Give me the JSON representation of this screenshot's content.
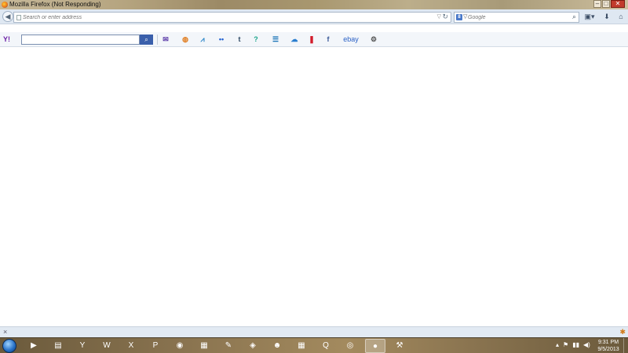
{
  "window": {
    "title": "Mozilla Firefox (Not Responding)",
    "buttons": {
      "minimize": "–",
      "maximize": "□",
      "close": "✕"
    }
  },
  "navbar": {
    "back_glyph": "◀",
    "url_placeholder": "Search or enter address",
    "search_engine_letter": "8",
    "search_placeholder": "Google",
    "dropdown_glyph": "▽",
    "reload_glyph": "↻",
    "search_glyph": "⌕",
    "icons": {
      "bookmarks": "▣▾",
      "downloads": "⬇",
      "home": "⌂"
    }
  },
  "yahoo_toolbar": {
    "logo": "Y!",
    "search_value": "",
    "search_button_glyph": "⌕",
    "items": [
      {
        "name": "mail-icon",
        "glyph": "✉",
        "color": "#5b3aa8"
      },
      {
        "name": "sports-icon",
        "glyph": "◍",
        "color": "#e07b1d"
      },
      {
        "name": "finance-icon",
        "glyph": "⩘",
        "color": "#1f7fc6"
      },
      {
        "name": "flickr-icon",
        "glyph": "••",
        "color": "#1f5fd0"
      },
      {
        "name": "tumblr-icon",
        "glyph": "t",
        "color": "#2c4762"
      },
      {
        "name": "answers-icon",
        "glyph": "?",
        "color": "#1aa58a"
      },
      {
        "name": "news-icon",
        "glyph": "☰",
        "color": "#1b75b8"
      },
      {
        "name": "weather-icon",
        "glyph": "☁",
        "color": "#2a7ecf"
      },
      {
        "name": "bookmark-icon",
        "glyph": "❚",
        "color": "#d21b2a"
      },
      {
        "name": "facebook-icon",
        "glyph": "f",
        "color": "#3b5998"
      },
      {
        "name": "ebay-icon",
        "glyph": "ebay",
        "color": "#2b61c6"
      },
      {
        "name": "settings-gear-icon",
        "glyph": "⚙",
        "color": "#555555"
      }
    ]
  },
  "addon_bar": {
    "close_glyph": "×",
    "addon_glyph": "✱"
  },
  "taskbar": {
    "items": [
      {
        "name": "media-center-icon",
        "glyph": "▶",
        "active": false
      },
      {
        "name": "explorer-folder-icon",
        "glyph": "▤",
        "active": false
      },
      {
        "name": "yahoo-messenger-icon",
        "glyph": "Y",
        "active": false
      },
      {
        "name": "word-icon",
        "glyph": "W",
        "active": false
      },
      {
        "name": "excel-icon",
        "glyph": "X",
        "active": false
      },
      {
        "name": "powerpoint-icon",
        "glyph": "P",
        "active": false
      },
      {
        "name": "network-icon",
        "glyph": "◉",
        "active": false
      },
      {
        "name": "archive-icon",
        "glyph": "▦",
        "active": false
      },
      {
        "name": "pen-app-icon",
        "glyph": "✎",
        "active": false
      },
      {
        "name": "hunger-games-icon",
        "glyph": "◈",
        "active": false
      },
      {
        "name": "mr-mrs-icon",
        "glyph": "☻",
        "active": false
      },
      {
        "name": "archive2-icon",
        "glyph": "▦",
        "active": false
      },
      {
        "name": "quicktime-icon",
        "glyph": "Q",
        "active": false
      },
      {
        "name": "chrome-like-icon",
        "glyph": "◎",
        "active": false
      },
      {
        "name": "firefox-icon",
        "glyph": "●",
        "active": true
      },
      {
        "name": "tools-icon",
        "glyph": "⚒",
        "active": false
      }
    ],
    "tray": {
      "arrow": "▴",
      "flag": "⚑",
      "network": "▮▮",
      "volume": "◀)"
    },
    "clock_time": "9:31 PM",
    "clock_date": "9/5/2013"
  }
}
